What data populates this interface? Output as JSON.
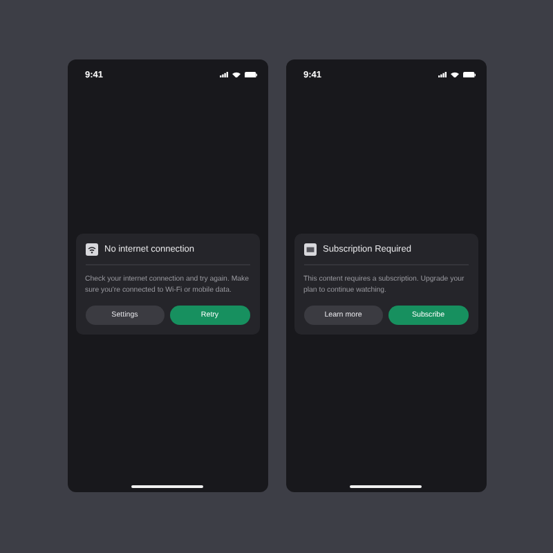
{
  "screens": [
    {
      "status_bar": {
        "time": "9:41"
      },
      "dialog": {
        "kind": "offline",
        "title": "No internet connection",
        "message": "Check your internet connection and try again. Make sure you're connected to Wi-Fi or mobile data.",
        "buttons": [
          {
            "label": "Settings",
            "kind": "secondary"
          },
          {
            "label": "Retry",
            "kind": "primary"
          }
        ]
      }
    },
    {
      "status_bar": {
        "time": "9:41"
      },
      "dialog": {
        "kind": "subscription",
        "title": "Subscription Required",
        "message": "This content requires a subscription. Upgrade your plan to continue watching.",
        "buttons": [
          {
            "label": "Learn more",
            "kind": "secondary"
          },
          {
            "label": "Subscribe",
            "kind": "primary"
          }
        ]
      }
    }
  ]
}
